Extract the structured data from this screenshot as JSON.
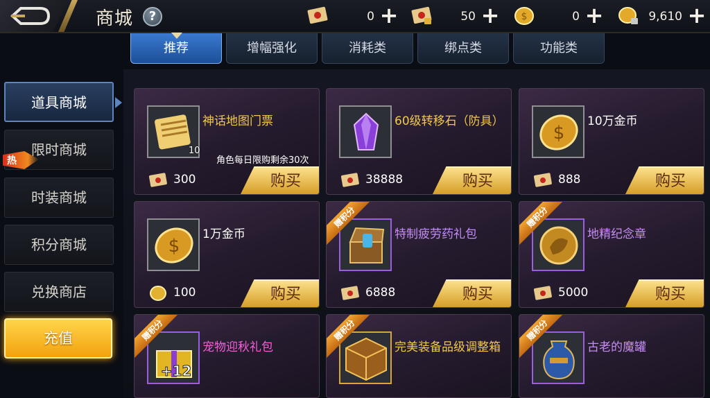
{
  "header": {
    "title": "商城",
    "help_icon": "?",
    "currencies": [
      {
        "icon": "red-ticket-icon",
        "value": "0",
        "plus": "+"
      },
      {
        "icon": "locked-ticket-icon",
        "value": "50",
        "plus": "+"
      },
      {
        "icon": "gold-coin-icon",
        "value": "0",
        "plus": "+"
      },
      {
        "icon": "locked-coin-icon",
        "value": "9,610",
        "plus": "+"
      }
    ]
  },
  "tabs": [
    {
      "label": "推荐",
      "active": true
    },
    {
      "label": "增幅强化",
      "active": false
    },
    {
      "label": "消耗类",
      "active": false
    },
    {
      "label": "绑点类",
      "active": false
    },
    {
      "label": "功能类",
      "active": false
    }
  ],
  "sidebar": {
    "items": [
      {
        "label": "道具商城",
        "active": true
      },
      {
        "label": "限时商城",
        "active": false
      },
      {
        "label": "时装商城",
        "active": false
      },
      {
        "label": "积分商城",
        "active": false
      },
      {
        "label": "兑换商店",
        "active": false
      }
    ],
    "hot_badge": "热",
    "recharge_label": "充值"
  },
  "buy_label": "购买",
  "ribbon_label": "赠积分",
  "items": [
    {
      "name": "神话地图门票",
      "name_color": "#f2c94a",
      "qty": "10",
      "limit": "角色每日限购剩余30次",
      "price": "300",
      "price_icon": "ticket-icon",
      "ribbon": false,
      "icon": "scroll-icon"
    },
    {
      "name": "60级转移石（防具）",
      "name_color": "#f2c94a",
      "qty": "",
      "limit": "",
      "price": "38888",
      "price_icon": "ticket-icon",
      "ribbon": false,
      "icon": "crystal-icon"
    },
    {
      "name": "10万金币",
      "name_color": "#ffffff",
      "qty": "",
      "limit": "",
      "price": "888",
      "price_icon": "ticket-icon",
      "ribbon": false,
      "icon": "gold-coin-icon"
    },
    {
      "name": "1万金币",
      "name_color": "#ffffff",
      "qty": "",
      "limit": "",
      "price": "100",
      "price_icon": "coin-icon",
      "ribbon": false,
      "icon": "gold-coin-icon"
    },
    {
      "name": "特制疲劳药礼包",
      "name_color": "#c58cf5",
      "qty": "",
      "limit": "",
      "price": "6888",
      "price_icon": "ticket-icon",
      "ribbon": true,
      "icon": "chest-icon"
    },
    {
      "name": "地精纪念章",
      "name_color": "#c58cf5",
      "qty": "",
      "limit": "",
      "price": "5000",
      "price_icon": "ticket-icon",
      "ribbon": true,
      "icon": "medal-icon"
    },
    {
      "name": "宠物迎秋礼包",
      "name_color": "#f35fd8",
      "qty": "",
      "limit": "",
      "price": "",
      "price_icon": "",
      "ribbon": true,
      "icon": "gift-box-icon"
    },
    {
      "name": "完美装备品级调整箱",
      "name_color": "#f2c94a",
      "qty": "",
      "limit": "",
      "price": "",
      "price_icon": "",
      "ribbon": true,
      "icon": "cube-icon"
    },
    {
      "name": "古老的魔罐",
      "name_color": "#c58cf5",
      "qty": "",
      "limit": "",
      "price": "",
      "price_icon": "",
      "ribbon": true,
      "icon": "jar-icon"
    }
  ]
}
